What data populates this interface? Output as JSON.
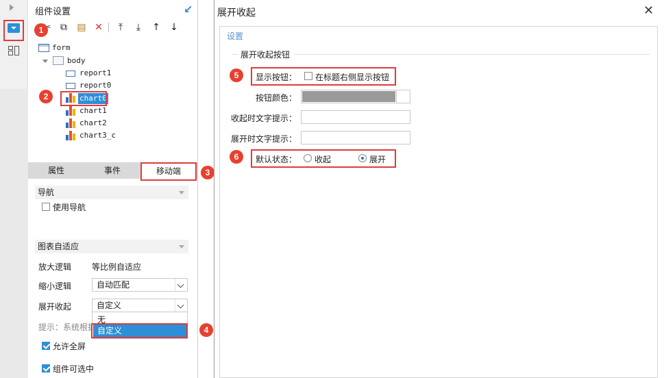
{
  "left_panel": {
    "title": "组件设置",
    "tree": {
      "form": "form",
      "body": "body",
      "items": [
        "report1",
        "report0",
        "chart0",
        "chart1",
        "chart2",
        "chart3_c"
      ]
    },
    "tabs": [
      "属性",
      "事件",
      "移动端"
    ],
    "nav_section": "导航",
    "use_nav_label": "使用导航",
    "adapt_section": "图表自适应",
    "zoom_in_label": "放大逻辑",
    "zoom_in_value": "等比例自适应",
    "zoom_out_label": "缩小逻辑",
    "zoom_out_value": "自动匹配",
    "expand_label": "展开收起",
    "expand_value": "自定义",
    "expand_options": [
      "无",
      "自定义"
    ],
    "hint": "提示：系统根据",
    "fullscreen_label": "允许全屏",
    "selectable_label": "组件可选中"
  },
  "dialog": {
    "title": "展开收起",
    "close": "✕",
    "settings": "设置",
    "group_title": "展开收起按钮",
    "show_button_label": "显示按钮：",
    "show_button_option": "在标题右侧显示按钮",
    "button_color_label": "按钮颜色：",
    "button_color_value": "#9a9a9a",
    "collapsed_hint_label": "收起时文字提示：",
    "expanded_hint_label": "展开时文字提示：",
    "default_state_label": "默认状态：",
    "state_options": [
      "收起",
      "展开"
    ],
    "default_state_selected": "展开"
  },
  "badges": [
    "1",
    "2",
    "3",
    "4",
    "5",
    "6"
  ],
  "colors": {
    "accent": "#2d8fd8",
    "annotation": "#e03a3a"
  }
}
